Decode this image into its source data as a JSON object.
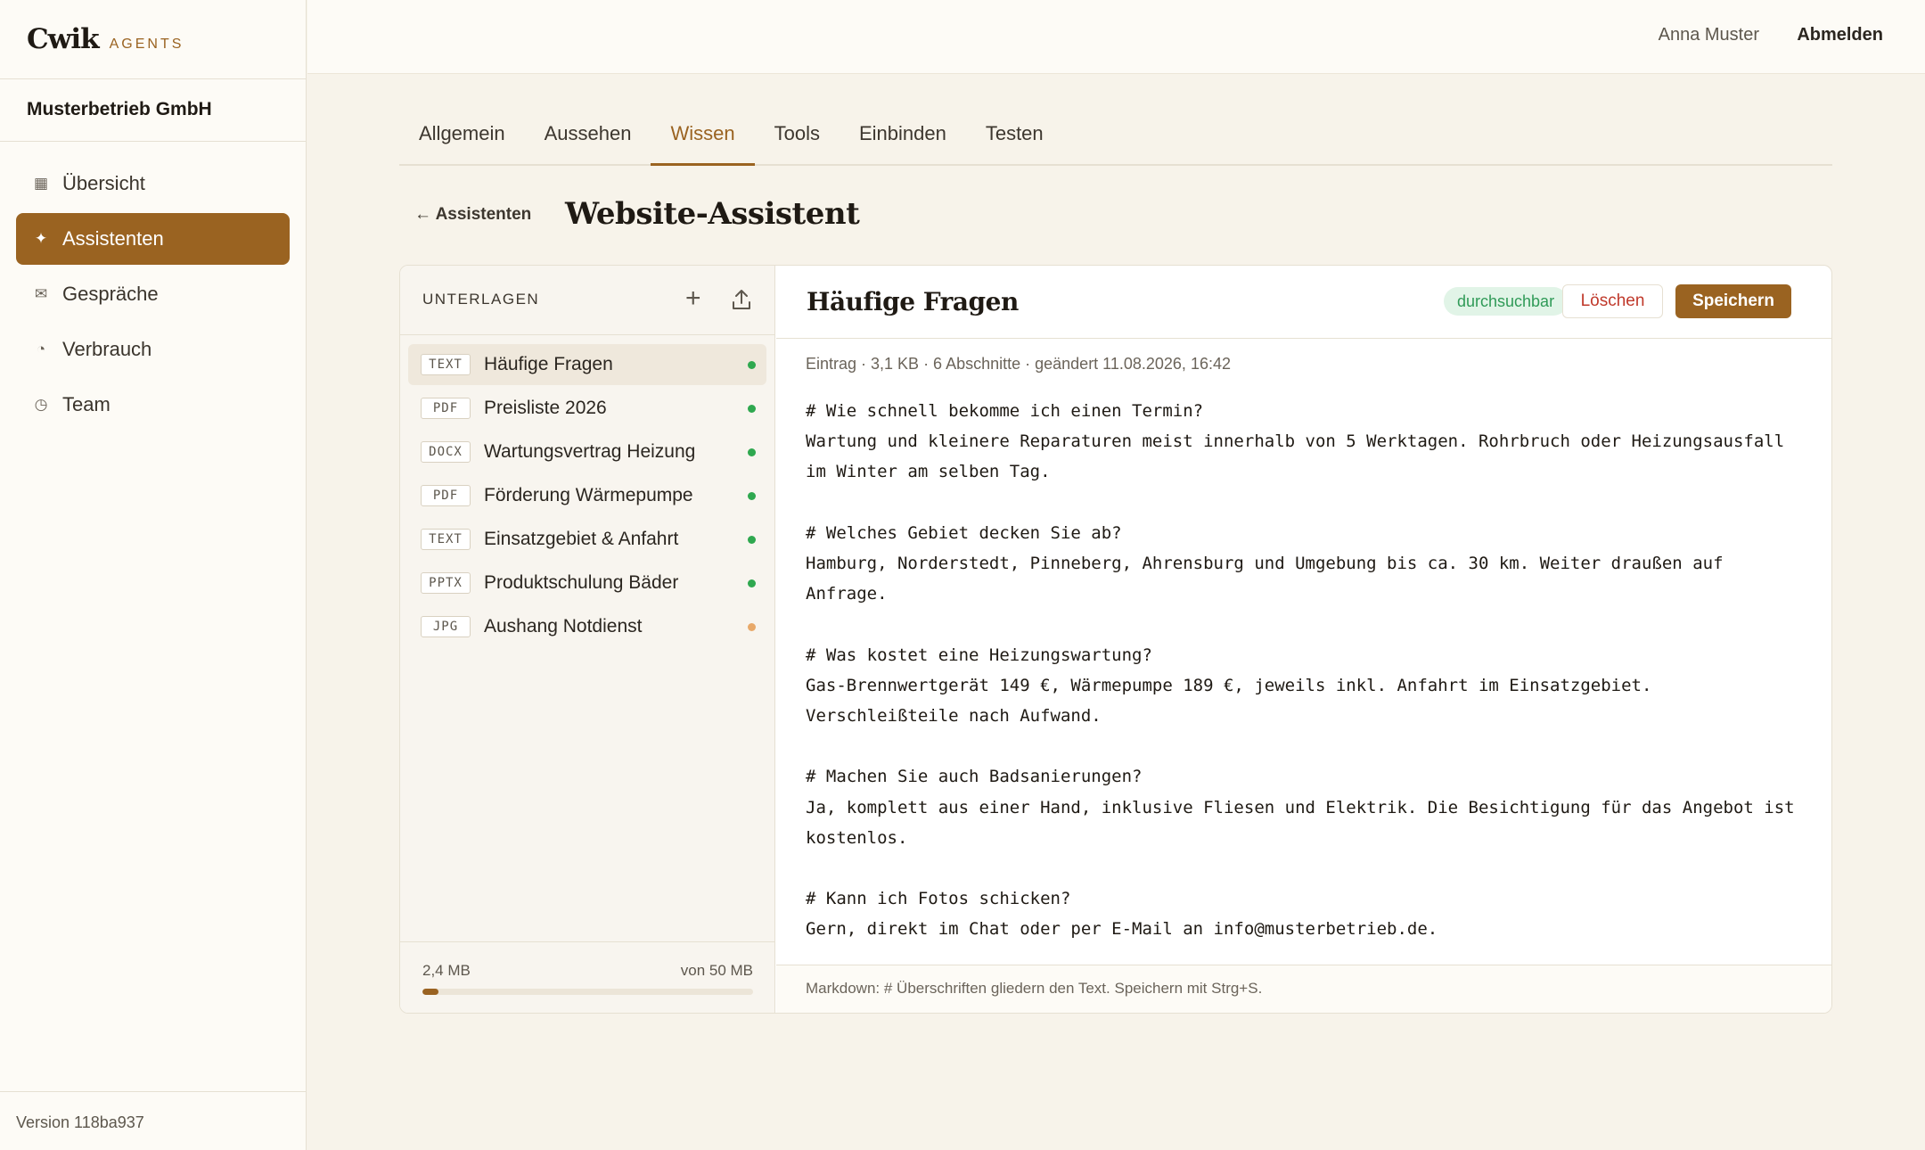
{
  "brand": {
    "name": "Cwik",
    "sub": "AGENTS"
  },
  "org": "Musterbetrieb GmbH",
  "nav": [
    {
      "label": "Übersicht",
      "icon": "▦",
      "active": false
    },
    {
      "label": "Assistenten",
      "icon": "✦",
      "active": true
    },
    {
      "label": "Gespräche",
      "icon": "✉",
      "active": false
    },
    {
      "label": "Verbrauch",
      "icon": "◔",
      "active": false
    },
    {
      "label": "Team",
      "icon": "◷",
      "active": false
    }
  ],
  "version": "Version 118ba937",
  "topbar": {
    "user": "Anna Muster",
    "logout": "Abmelden"
  },
  "tabs": [
    "Allgemein",
    "Aussehen",
    "Wissen",
    "Tools",
    "Einbinden",
    "Testen"
  ],
  "active_tab": "Wissen",
  "back_link": "← Assistenten",
  "page_title": "Website-Assistent",
  "docs": {
    "title": "UNTERLAGEN",
    "items": [
      {
        "type": "TEXT",
        "name": "Häufige Fragen",
        "status": "ready",
        "active": true
      },
      {
        "type": "PDF",
        "name": "Preisliste 2026",
        "status": "ready",
        "active": false
      },
      {
        "type": "DOCX",
        "name": "Wartungsvertrag Heizung",
        "status": "ready",
        "active": false
      },
      {
        "type": "PDF",
        "name": "Förderung Wärmepumpe",
        "status": "ready",
        "active": false
      },
      {
        "type": "TEXT",
        "name": "Einsatzgebiet & Anfahrt",
        "status": "ready",
        "active": false
      },
      {
        "type": "PPTX",
        "name": "Produktschulung Bäder",
        "status": "ready",
        "active": false
      },
      {
        "type": "JPG",
        "name": "Aushang Notdienst",
        "status": "pending",
        "active": false
      }
    ],
    "storage_used": "2,4 MB",
    "storage_total": "von 50 MB",
    "storage_fraction": 0.048
  },
  "colors": {
    "ready": "#2fa84f",
    "pending": "#e8a96a",
    "accent": "#9a6321"
  },
  "editor": {
    "title": "Häufige Fragen",
    "badge": "durchsuchbar",
    "delete": "Löschen",
    "save": "Speichern",
    "meta": "Eintrag · 3,1 KB · 6 Abschnitte · geändert 11.08.2026, 16:42",
    "content": "# Wie schnell bekomme ich einen Termin?\nWartung und kleinere Reparaturen meist innerhalb von 5 Werktagen. Rohrbruch oder Heizungsausfall\nim Winter am selben Tag.\n\n# Welches Gebiet decken Sie ab?\nHamburg, Norderstedt, Pinneberg, Ahrensburg und Umgebung bis ca. 30 km. Weiter draußen auf\nAnfrage.\n\n# Was kostet eine Heizungswartung?\nGas-Brennwertgerät 149 €, Wärmepumpe 189 €, jeweils inkl. Anfahrt im Einsatzgebiet.\nVerschleißteile nach Aufwand.\n\n# Machen Sie auch Badsanierungen?\nJa, komplett aus einer Hand, inklusive Fliesen und Elektrik. Die Besichtigung für das Angebot ist\nkostenlos.\n\n# Kann ich Fotos schicken?\nGern, direkt im Chat oder per E-Mail an info@musterbetrieb.de.",
    "hint": "Markdown: # Überschriften gliedern den Text. Speichern mit Strg+S."
  }
}
